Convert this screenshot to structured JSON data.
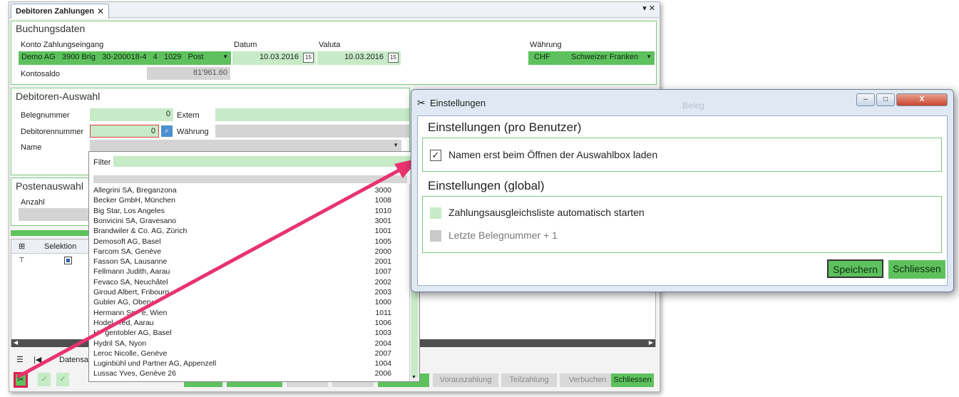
{
  "main": {
    "tab_title": "Debitoren Zahlungen",
    "tab_close": "✕",
    "window_controls": "▾ ✕",
    "buchung": {
      "title": "Buchungsdaten",
      "konto_label": "Konto Zahlungseingang",
      "konto_value": "Demo AG   3900 Brig   30-200018-4   4   1029   Post",
      "datum_label": "Datum",
      "datum_value": "10.03.2016",
      "valuta_label": "Valuta",
      "valuta_value": "10.03.2016",
      "waehrung_label": "Währung",
      "waehrung_code": "CHF",
      "waehrung_name": "Schweizer Franken",
      "kontosaldo_label": "Kontosaldo",
      "kontosaldo_value": "81'961.60",
      "calendar_day": "15"
    },
    "debitoren": {
      "title": "Debitoren-Auswahl",
      "belegnummer_label": "Belegnummer",
      "belegnummer_value": "0",
      "extern_label": "Extern",
      "debitorennummer_label": "Debitorennummer",
      "debitorennummer_value": "0",
      "waehrung_label": "Währung",
      "name_label": "Name"
    },
    "posten": {
      "title": "Postenauswahl",
      "anzahl_label": "Anzahl"
    },
    "grid": {
      "selektion_label": "Selektion",
      "datensatz_label": "Datensa"
    },
    "buttons": {
      "vorauszahlung": "Vorauszahlung",
      "teilzahlung": "Teilzahlung",
      "verbuchen": "Verbuchen",
      "schliessen": "Schliessen"
    }
  },
  "list": {
    "filter_label": "Filter",
    "items": [
      {
        "name": "Allegrini SA, Breganzona",
        "code": "3000"
      },
      {
        "name": "Becker GmbH, München",
        "code": "1008"
      },
      {
        "name": "Big Star, Los Angeles",
        "code": "1010"
      },
      {
        "name": "Bonvicini SA, Gravesano",
        "code": "3001"
      },
      {
        "name": "Brandwiler & Co. AG, Zürich",
        "code": "1001"
      },
      {
        "name": "Demosoft AG, Basel",
        "code": "1005"
      },
      {
        "name": "Farcom SA, Genève",
        "code": "2000"
      },
      {
        "name": "Fasson SA, Lausanne",
        "code": "2001"
      },
      {
        "name": "Fellmann Judith, Aarau",
        "code": "1007"
      },
      {
        "name": "Fevaco SA, Neuchâtel",
        "code": "2002"
      },
      {
        "name": "Giroud Albert, Fribourg",
        "code": "2003"
      },
      {
        "name": "Gubler AG, Oberv",
        "code": "1000"
      },
      {
        "name": "Hermann Sp   e, Wien",
        "code": "1011"
      },
      {
        "name": "Hodel   red, Aarau",
        "code": "1006"
      },
      {
        "name": "H   gentobler AG, Basel",
        "code": "1003"
      },
      {
        "name": "Hydril SA, Nyon",
        "code": "2004"
      },
      {
        "name": "Leroc Nicolle, Genève",
        "code": "2007"
      },
      {
        "name": "Luginbühl und Partner AG, Appenzell",
        "code": "1004"
      },
      {
        "name": "Lussac Yves, Genève 26",
        "code": "2006"
      }
    ]
  },
  "dialog": {
    "title": "Einstellungen",
    "section_user": "Einstellungen (pro Benutzer)",
    "option_names": "Namen erst beim Öffnen der Auswahlbox laden",
    "option_names_checked": true,
    "section_global": "Einstellungen (global)",
    "option_autostart": "Zahlungsausgleichsliste automatisch starten",
    "option_belegnummer": "Letzte Belegnummer + 1",
    "save_label": "Speichern",
    "close_label": "Schliessen",
    "background_text": "Beleg",
    "ctrl_minimize": "–",
    "ctrl_maximize": "□",
    "ctrl_close": "X",
    "check_mark": "✓"
  },
  "colors": {
    "accent_green": "#5ec15e",
    "light_green": "#c7ebc7",
    "arrow": "#e8336e"
  }
}
